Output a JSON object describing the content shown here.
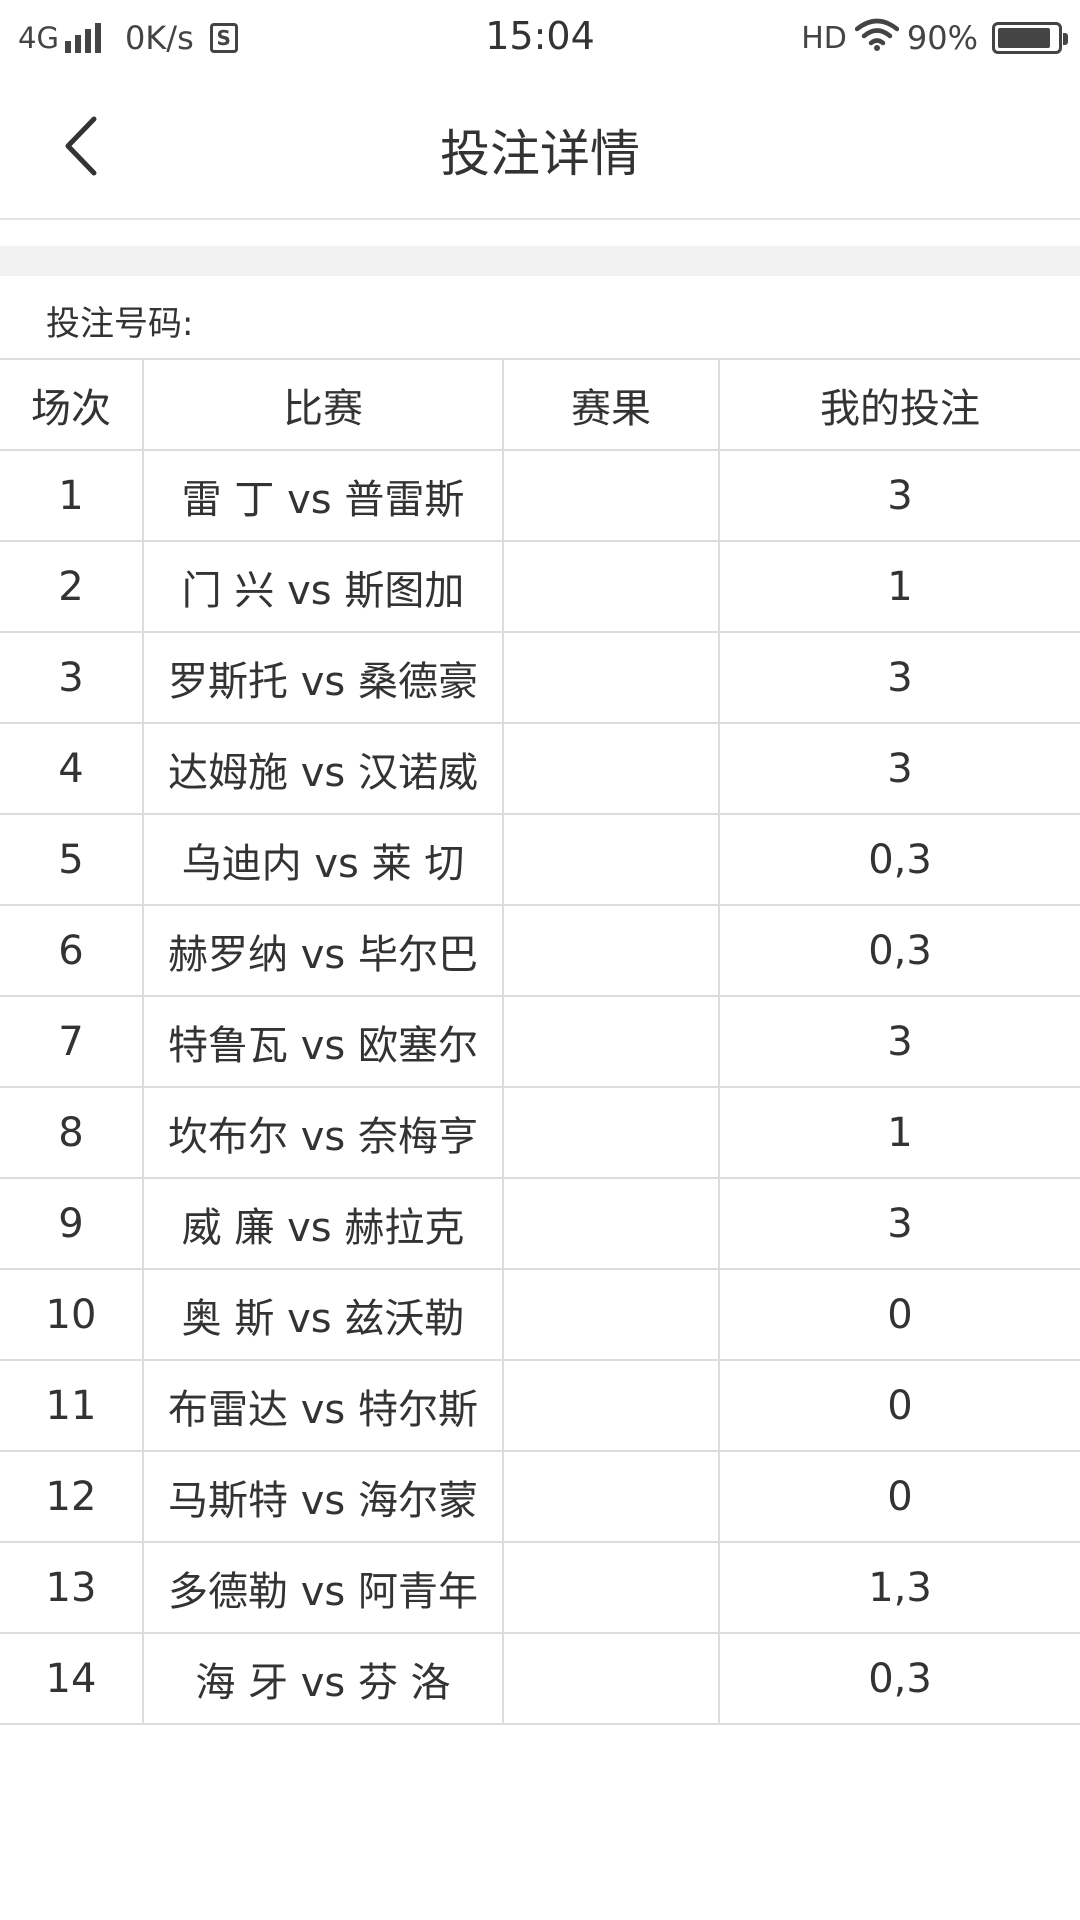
{
  "status_bar": {
    "network": "4G",
    "speed": "0K/s",
    "s_icon": "S",
    "time": "15:04",
    "hd": "HD",
    "battery": "90%",
    "battery_level": 0.9
  },
  "nav": {
    "title": "投注详情"
  },
  "bet_numbers_label": "投注号码:",
  "table": {
    "headers": [
      "场次",
      "比赛",
      "赛果",
      "我的投注"
    ],
    "rows": [
      {
        "no": "1",
        "match": "雷 丁 vs 普雷斯",
        "result": "",
        "bet": "3"
      },
      {
        "no": "2",
        "match": "门 兴 vs 斯图加",
        "result": "",
        "bet": "1"
      },
      {
        "no": "3",
        "match": "罗斯托 vs 桑德豪",
        "result": "",
        "bet": "3"
      },
      {
        "no": "4",
        "match": "达姆施 vs 汉诺威",
        "result": "",
        "bet": "3"
      },
      {
        "no": "5",
        "match": "乌迪内 vs 莱 切",
        "result": "",
        "bet": "0,3"
      },
      {
        "no": "6",
        "match": "赫罗纳 vs 毕尔巴",
        "result": "",
        "bet": "0,3"
      },
      {
        "no": "7",
        "match": "特鲁瓦 vs 欧塞尔",
        "result": "",
        "bet": "3"
      },
      {
        "no": "8",
        "match": "坎布尔 vs 奈梅亨",
        "result": "",
        "bet": "1"
      },
      {
        "no": "9",
        "match": "威 廉 vs 赫拉克",
        "result": "",
        "bet": "3"
      },
      {
        "no": "10",
        "match": "奥 斯 vs 兹沃勒",
        "result": "",
        "bet": "0"
      },
      {
        "no": "11",
        "match": "布雷达 vs 特尔斯",
        "result": "",
        "bet": "0"
      },
      {
        "no": "12",
        "match": "马斯特 vs 海尔蒙",
        "result": "",
        "bet": "0"
      },
      {
        "no": "13",
        "match": "多德勒 vs 阿青年",
        "result": "",
        "bet": "1,3"
      },
      {
        "no": "14",
        "match": "海 牙 vs 芬 洛",
        "result": "",
        "bet": "0,3"
      }
    ]
  },
  "icons": {
    "back": "chevron-left-icon",
    "signal": "signal-icon",
    "wifi": "wifi-icon",
    "battery": "battery-icon"
  }
}
